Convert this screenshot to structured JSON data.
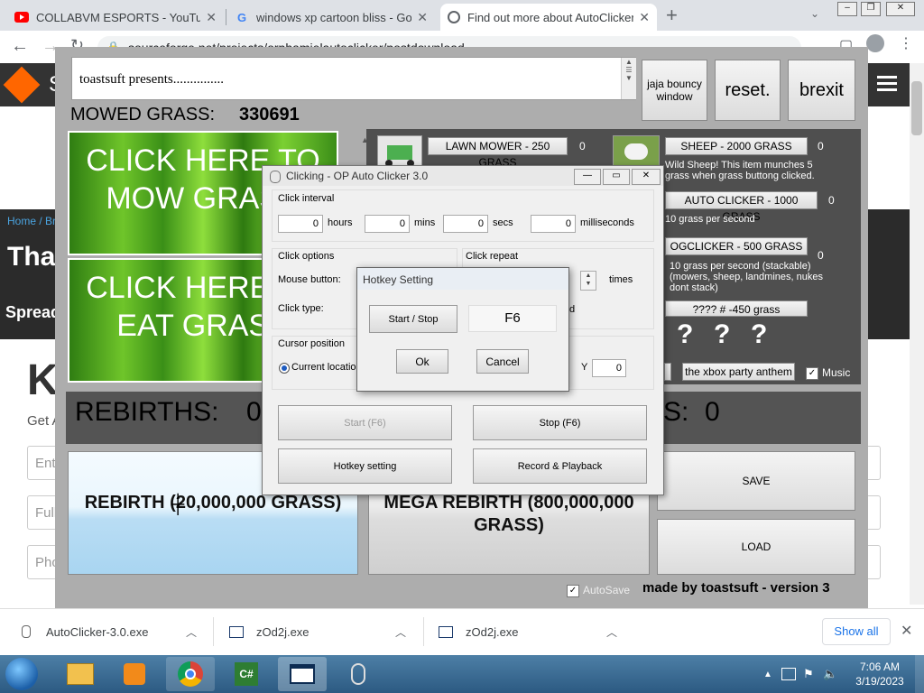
{
  "browser": {
    "tabs": [
      {
        "title": "COLLABVM ESPORTS - YouTube",
        "icon": "youtube-icon"
      },
      {
        "title": "windows xp cartoon bliss - Goog",
        "icon": "google-icon"
      },
      {
        "title": "Find out more about AutoClicker",
        "icon": "web-icon"
      }
    ],
    "url": "sourceforge.net/projects/orphamielautoclicker/postdownload"
  },
  "site": {
    "breadcrumb": "Home / Br",
    "hero_title": "Thar",
    "spread": "Spread",
    "body_heading": "K",
    "body_sub": "Get A",
    "inputs": [
      "Ent",
      "Full",
      "Pho"
    ]
  },
  "game": {
    "presents": "toastsuft presents...............",
    "buttons": {
      "jaja": "jaja bouncy window",
      "reset": "reset.",
      "brexit": "brexit"
    },
    "mowed_label": "MOWED GRASS:",
    "mowed_value": "330691",
    "click_mow": "CLICK HERE TO MOW GRASS",
    "click_eat": "CLICK HERE TO EAT GRASS",
    "shop": {
      "lawn_mower": {
        "label": "LAWN MOWER - 250 GRASS",
        "count": "0"
      },
      "sheep": {
        "label": "SHEEP - 2000 GRASS",
        "count": "0",
        "desc": "Wild Sheep! This item munches 5 grass when grass buttong clicked."
      },
      "auto_clicker": {
        "label": "AUTO CLICKER - 1000 GRASS",
        "count": "0",
        "desc": "10 grass per second"
      },
      "ogclicker": {
        "label": "OGCLICKER - 500 GRASS",
        "count": "0",
        "desc": "10 grass per second (stackable) (mowers, sheep, landmines, nukes dont stack)"
      },
      "mystery": {
        "label": "???? # -450 grass"
      },
      "xbox": "the xbox party anthem",
      "music": "Music"
    },
    "rebirths_label": "REBIRTHS:",
    "rebirths_value": "0",
    "mega_rebirths_value": "0",
    "rebirth_btn": "REBIRTH (20,000,000 GRASS)",
    "mega_rebirth_btn": "MEGA REBIRTH (800,000,000 GRASS)",
    "save": "SAVE",
    "load": "LOAD",
    "autosave": "AutoSave",
    "credit": "made by toastsuft - version 3"
  },
  "autoclicker": {
    "title": "Clicking - OP Auto Clicker 3.0",
    "click_interval": "Click interval",
    "hours_value": "0",
    "hours": "hours",
    "mins_value": "0",
    "mins": "mins",
    "secs_value": "0",
    "secs": "secs",
    "ms_value": "0",
    "milliseconds": "milliseconds",
    "click_options": "Click options",
    "mouse_button": "Mouse button:",
    "click_type": "Click type:",
    "click_repeat": "Click repeat",
    "times": "times",
    "d": "d",
    "cursor_position": "Cursor position",
    "current_location": "Current location",
    "y_label": "Y",
    "y_value": "0",
    "start": "Start (F6)",
    "stop": "Stop (F6)",
    "hotkey_setting": "Hotkey setting",
    "record": "Record & Playback"
  },
  "hotkey": {
    "title": "Hotkey Setting",
    "start_stop": "Start / Stop",
    "key": "F6",
    "ok": "Ok",
    "cancel": "Cancel"
  },
  "downloads": {
    "items": [
      "AutoClicker-3.0.exe",
      "zOd2j.exe",
      "zOd2j.exe"
    ],
    "show_all": "Show all"
  },
  "taskbar": {
    "time": "7:06 AM",
    "date": "3/19/2023"
  }
}
